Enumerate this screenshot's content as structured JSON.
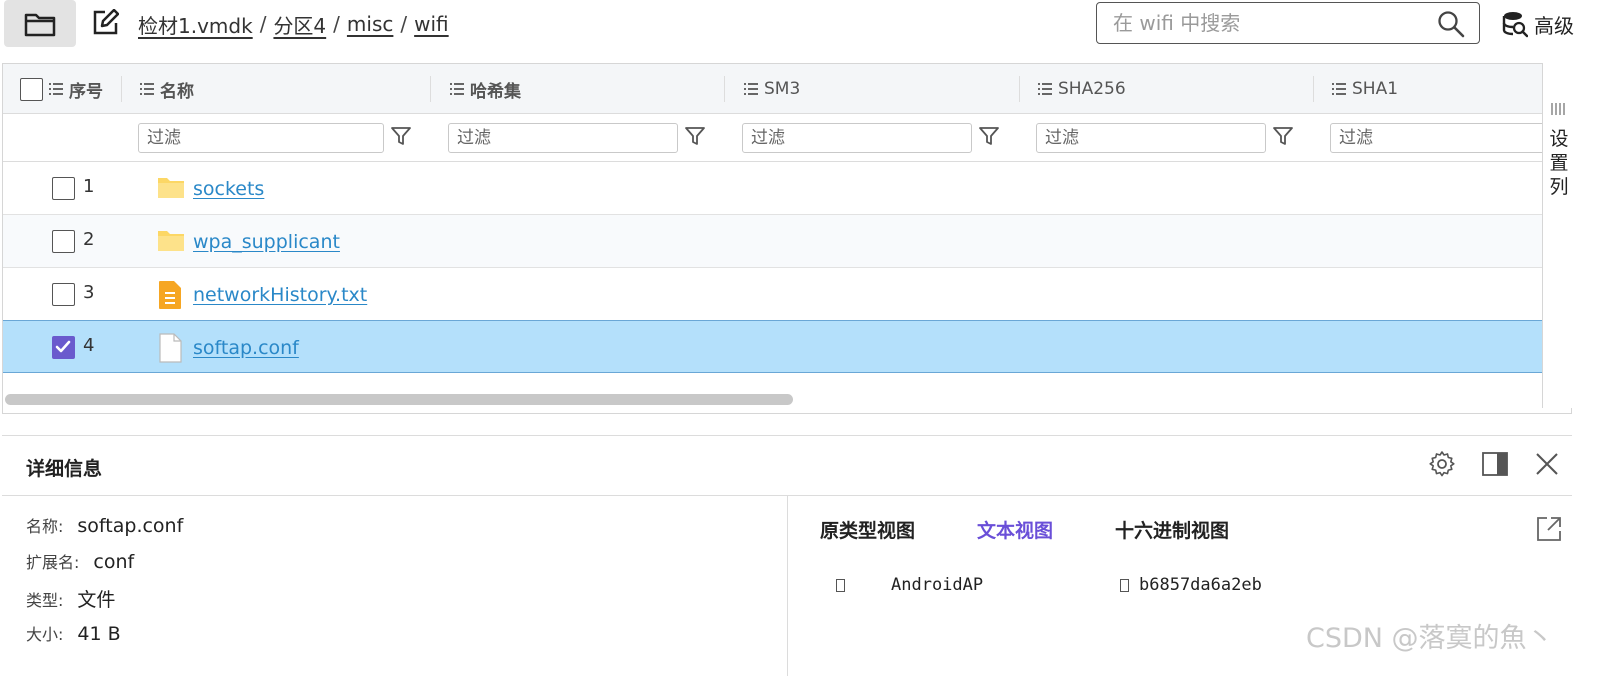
{
  "toolbar": {
    "breadcrumb": [
      "检材1.vmdk",
      "分区4",
      "misc",
      "wifi"
    ],
    "breadcrumb_separator": "/",
    "search_placeholder": "在 wifi 中搜索",
    "advanced_label": "高级"
  },
  "table": {
    "columns": [
      "序号",
      "名称",
      "哈希集",
      "SM3",
      "SHA256",
      "SHA1"
    ],
    "filter_placeholder": "过滤",
    "rows": [
      {
        "index": "1",
        "name": "sockets",
        "type": "folder",
        "checked": false
      },
      {
        "index": "2",
        "name": "wpa_supplicant",
        "type": "folder",
        "checked": false
      },
      {
        "index": "3",
        "name": "networkHistory.txt",
        "type": "text-file",
        "checked": false
      },
      {
        "index": "4",
        "name": "softap.conf",
        "type": "file",
        "checked": true
      }
    ],
    "side_panel_label": "设置列"
  },
  "details": {
    "title": "详细信息",
    "fields": [
      {
        "label": "名称:",
        "value": "softap.conf"
      },
      {
        "label": "扩展名:",
        "value": "conf"
      },
      {
        "label": "类型:",
        "value": "文件"
      },
      {
        "label": "大小:",
        "value": "41 B"
      }
    ],
    "tabs": [
      "原类型视图",
      "文本视图",
      "十六进制视图"
    ],
    "active_tab": "文本视图",
    "text_content": [
      "AndroidAP",
      "b6857da6a2eb"
    ]
  },
  "watermark": "CSDN @落寞的魚丶",
  "colors": {
    "accent": "#6a4fd8",
    "link": "#2a88c8",
    "selected_row": "#b4e0fb",
    "folder": "#fcd765",
    "text_file": "#f6a623"
  }
}
